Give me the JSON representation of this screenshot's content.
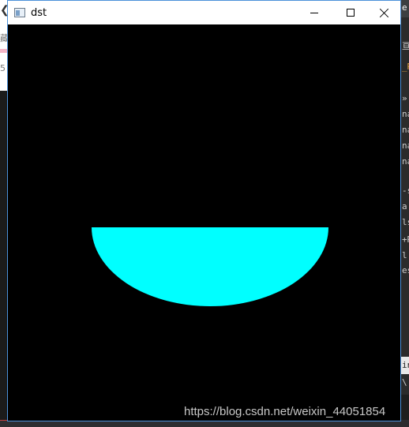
{
  "window": {
    "title": "dst",
    "controls": {
      "minimize": "minimize",
      "maximize": "maximize",
      "close": "close"
    }
  },
  "canvas": {
    "background_color": "#000000",
    "shape": {
      "type": "half-ellipse",
      "fill_color": "#00ffff"
    }
  },
  "background": {
    "left_fragments": [
      "藏",
      "5"
    ],
    "right_fragments": [
      "e",
      "亘",
      "_R",
      "»",
      "na",
      "na",
      "na",
      "na",
      "-s",
      "a",
      "ls",
      "+R",
      "l",
      "es",
      "in",
      "\\"
    ]
  },
  "watermark": "https://blog.csdn.net/weixin_44051854"
}
